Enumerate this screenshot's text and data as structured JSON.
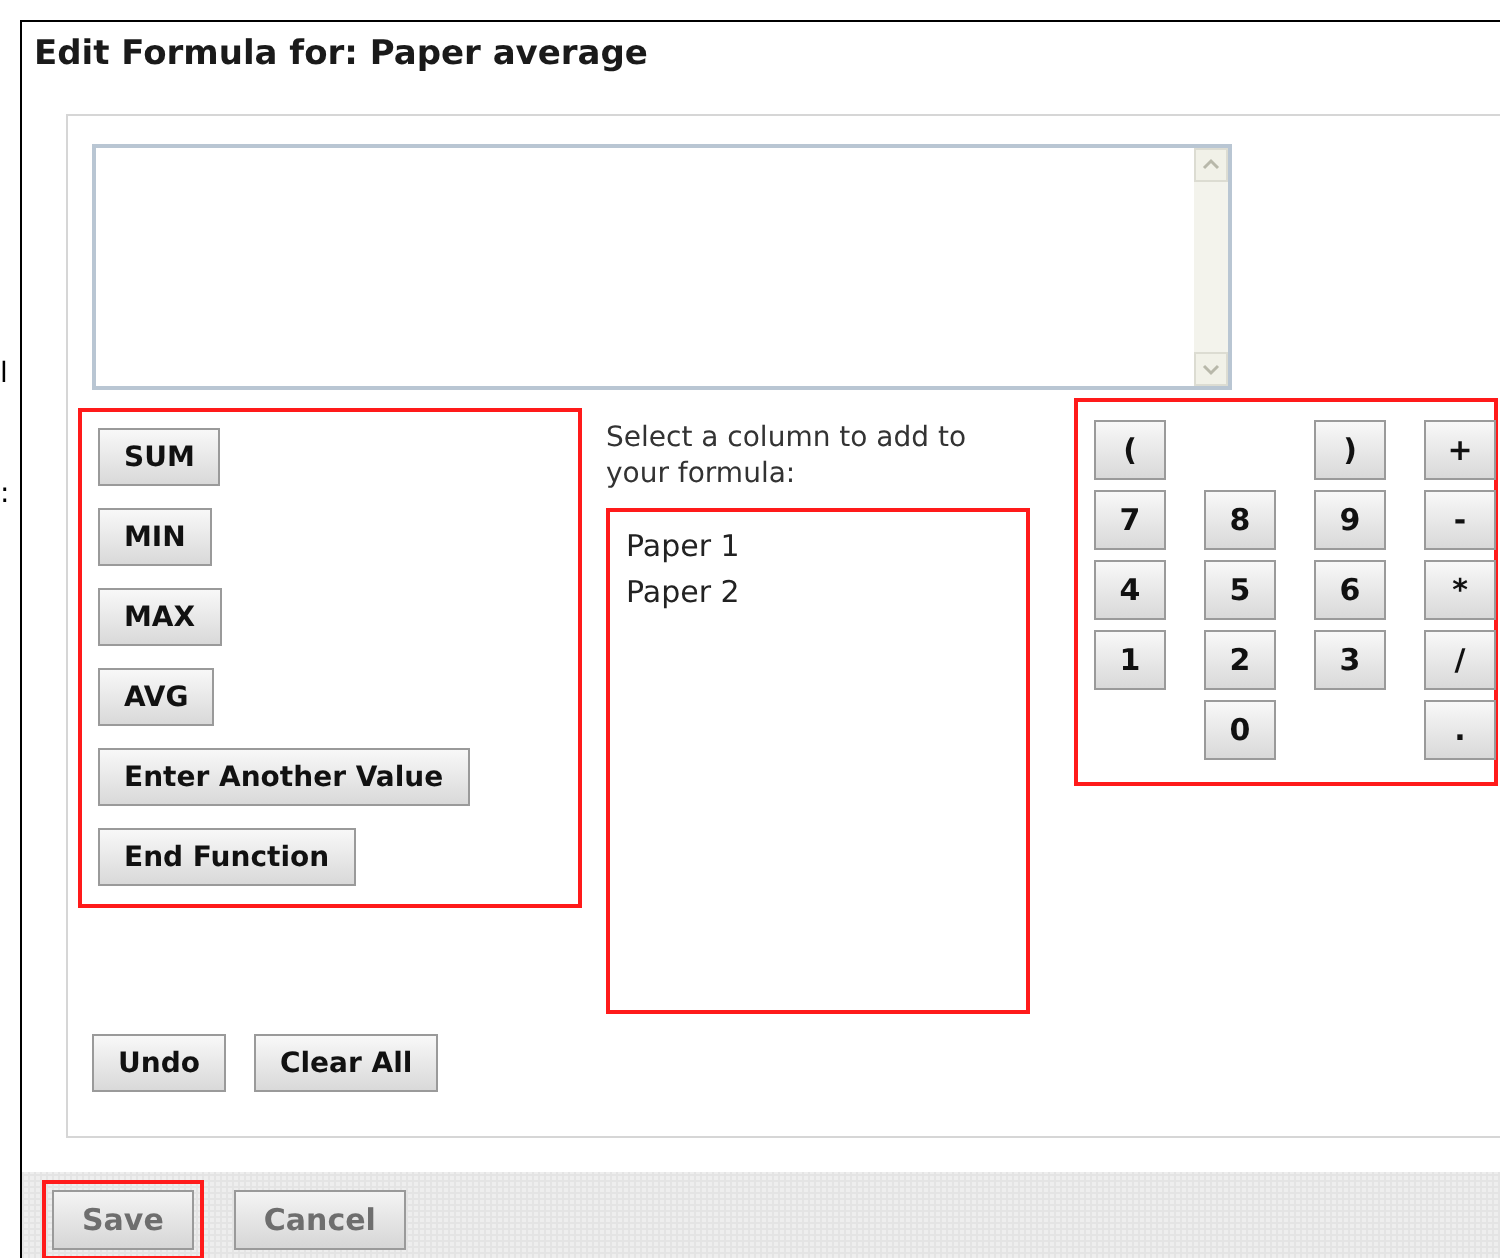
{
  "edge_fragments": [
    "l",
    ":"
  ],
  "dialog": {
    "title": "Edit Formula for: Paper average"
  },
  "functions": {
    "highlighted": true,
    "buttons": [
      "SUM",
      "MIN",
      "MAX",
      "AVG",
      "Enter Another Value",
      "End Function"
    ]
  },
  "column_list": {
    "label": "Select a column to add to your formula:",
    "highlighted": true,
    "items": [
      {
        "label": "Paper 1",
        "selected": false
      },
      {
        "label": "Paper 2",
        "selected": false
      }
    ]
  },
  "keypad": {
    "highlighted": true,
    "rows": [
      [
        {
          "kind": "key",
          "label": "("
        },
        {
          "kind": "blank"
        },
        {
          "kind": "key",
          "label": ")"
        },
        {
          "kind": "key",
          "label": "+"
        }
      ],
      [
        {
          "kind": "key",
          "label": "7"
        },
        {
          "kind": "key",
          "label": "8"
        },
        {
          "kind": "key",
          "label": "9"
        },
        {
          "kind": "key",
          "label": "-"
        }
      ],
      [
        {
          "kind": "key",
          "label": "4"
        },
        {
          "kind": "key",
          "label": "5"
        },
        {
          "kind": "key",
          "label": "6"
        },
        {
          "kind": "key",
          "label": "*"
        }
      ],
      [
        {
          "kind": "key",
          "label": "1"
        },
        {
          "kind": "key",
          "label": "2"
        },
        {
          "kind": "key",
          "label": "3"
        },
        {
          "kind": "key",
          "label": "/"
        }
      ],
      [
        {
          "kind": "blank"
        },
        {
          "kind": "key",
          "label": "0"
        },
        {
          "kind": "blank"
        },
        {
          "kind": "key",
          "label": "."
        }
      ]
    ]
  },
  "edit_buttons": [
    "Undo",
    "Clear All"
  ],
  "footer": {
    "buttons": [
      {
        "label": "Save",
        "disabled": true,
        "highlighted": true
      },
      {
        "label": "Cancel",
        "disabled": true,
        "highlighted": false
      }
    ]
  }
}
